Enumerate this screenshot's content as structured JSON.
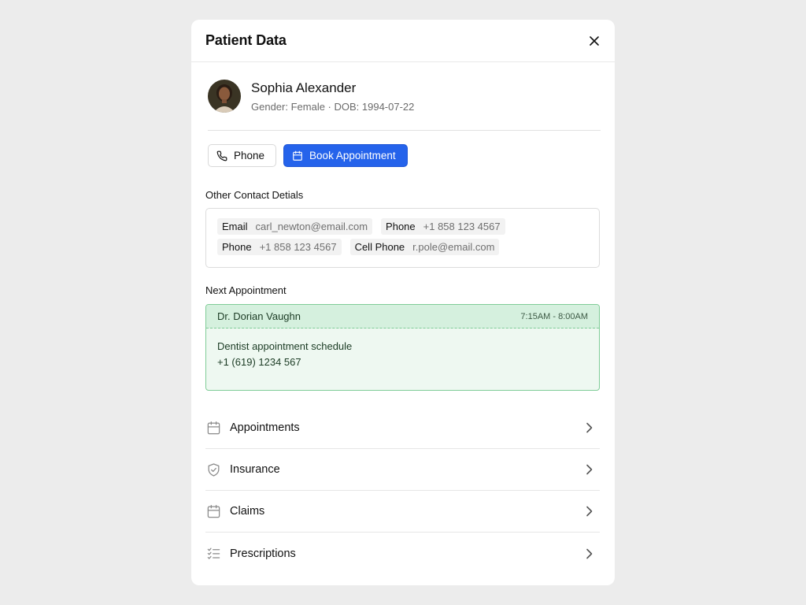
{
  "header": {
    "title": "Patient Data",
    "close_icon": "close-icon"
  },
  "patient": {
    "name": "Sophia Alexander",
    "meta": "Gender: Female · DOB: 1994-07-22"
  },
  "actions": {
    "phone_label": "Phone",
    "phone_icon": "phone-icon",
    "book_label": "Book Appointment",
    "book_icon": "calendar-icon",
    "primary_color": "#2563eb"
  },
  "contacts": {
    "section_label": "Other Contact Detials",
    "rows": [
      [
        {
          "key": "Email",
          "value": "carl_newton@email.com"
        },
        {
          "key": "Phone",
          "value": "+1 858 123 4567"
        }
      ],
      [
        {
          "key": "Phone",
          "value": "+1 858 123 4567"
        },
        {
          "key": "Cell Phone",
          "value": "r.pole@email.com"
        }
      ]
    ]
  },
  "next_appointment": {
    "section_label": "Next Appointment",
    "doctor": "Dr. Dorian Vaughn",
    "time": "7:15AM - 8:00AM",
    "description": "Dentist appointment schedule",
    "phone": "+1 (619) 1234 567",
    "accent_color": "#7fcc97"
  },
  "nav": [
    {
      "label": "Appointments",
      "icon": "calendar-icon"
    },
    {
      "label": "Insurance",
      "icon": "shield-check-icon"
    },
    {
      "label": "Claims",
      "icon": "calendar-icon"
    },
    {
      "label": "Prescriptions",
      "icon": "checklist-icon"
    }
  ]
}
